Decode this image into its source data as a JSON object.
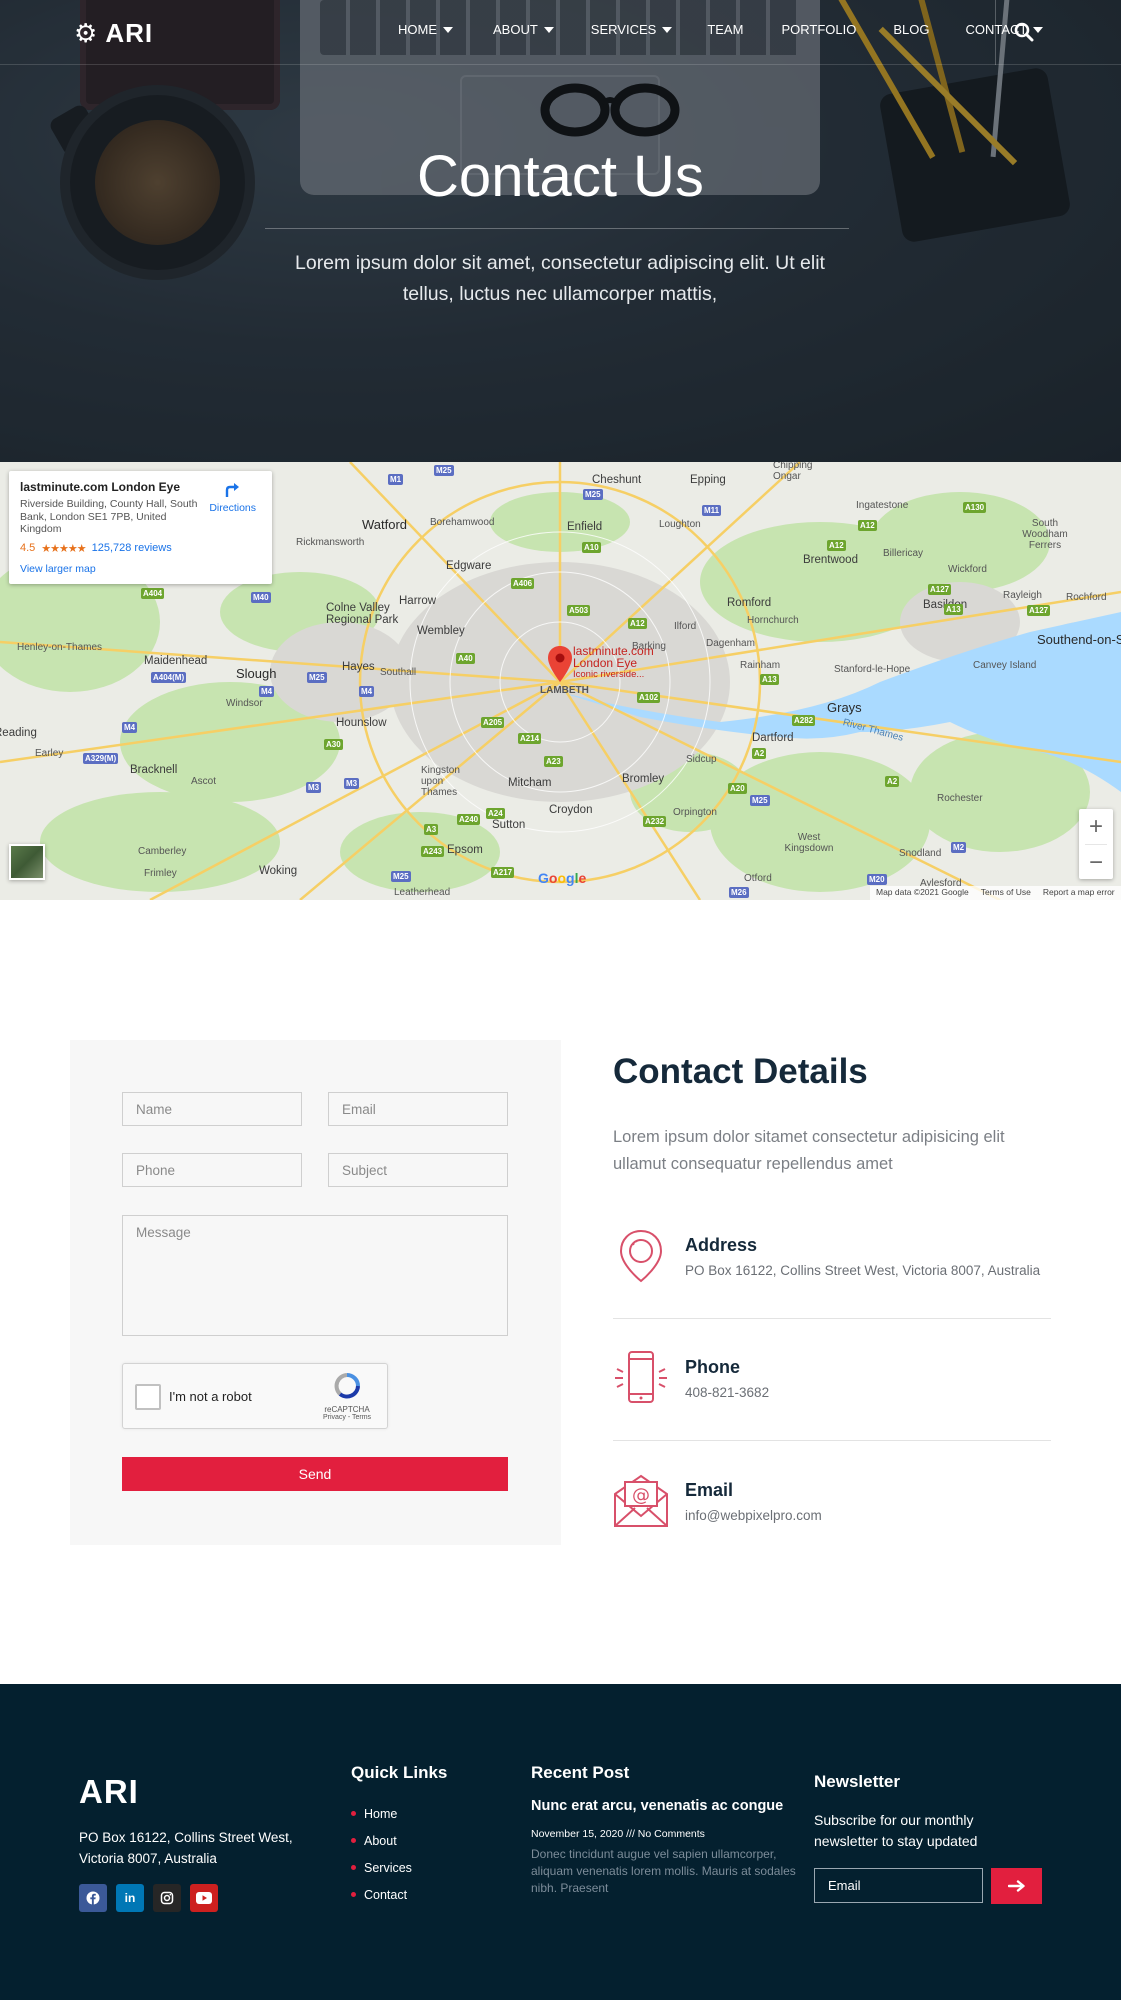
{
  "nav": {
    "logo": "ARI",
    "items": [
      {
        "label": "HOME",
        "has_dropdown": true
      },
      {
        "label": "ABOUT",
        "has_dropdown": true
      },
      {
        "label": "SERVICES",
        "has_dropdown": true
      },
      {
        "label": "TEAM",
        "has_dropdown": false
      },
      {
        "label": "PORTFOLIO",
        "has_dropdown": false
      },
      {
        "label": "BLOG",
        "has_dropdown": false
      },
      {
        "label": "CONTACT",
        "has_dropdown": true
      }
    ],
    "search_icon": "search-icon"
  },
  "hero": {
    "title": "Contact Us",
    "subtitle": "Lorem ipsum dolor sit amet, consectetur adipiscing elit. Ut elit tellus, luctus nec ullamcorper mattis,"
  },
  "map": {
    "place_name": "lastminute.com London Eye",
    "address": "Riverside Building, County Hall, South Bank, London SE1 7PB, United Kingdom",
    "rating": "4.5",
    "stars": "★★★★★",
    "reviews": "125,728 reviews",
    "directions": "Directions",
    "view_larger": "View larger map",
    "pin_title": "lastminute.com",
    "pin_title2": "London Eye",
    "pin_sub": "Iconic riverside...",
    "zoom_in": "+",
    "zoom_out": "−",
    "google": "Google",
    "attribution": [
      "Map data ©2021 Google",
      "Terms of Use",
      "Report a map error"
    ],
    "places": [
      "Cheshunt",
      "Epping",
      "Chipping Ongar",
      "Watford",
      "Borehamwood",
      "Enfield",
      "Loughton",
      "Ingatestone",
      "Rickmansworth",
      "Brentwood",
      "Billericay",
      "South Woodham Ferrers",
      "Edgware",
      "Colne Valley Regional Park",
      "Harrow",
      "Romford",
      "Wickford",
      "Rayleigh",
      "Rochford",
      "Hornchurch",
      "Basildon",
      "Southend-on-Sea",
      "Wembley",
      "Ilford",
      "Barking",
      "Dagenham",
      "Henley-on-Thames",
      "Maidenhead",
      "Slough",
      "Hayes",
      "Southall",
      "LAMBETH",
      "Rainham",
      "Stanford-le-Hope",
      "Canvey Island",
      "Windsor",
      "Hounslow",
      "Grays",
      "River Thames",
      "Reading",
      "Earley",
      "Bracknell",
      "Ascot",
      "Dartford",
      "Kingston upon Thames",
      "Mitcham",
      "Sidcup",
      "Bromley",
      "Croydon",
      "Orpington",
      "Rochester",
      "Sutton",
      "Camberley",
      "Epsom",
      "West Kingsdown",
      "Snodland",
      "Woking",
      "Frimley",
      "Leatherhead",
      "Otford",
      "Aylesford"
    ],
    "roads": [
      "M25",
      "M1",
      "M25",
      "M11",
      "A10",
      "A12",
      "A130",
      "A12",
      "A127",
      "A127",
      "A13",
      "A404",
      "M40",
      "A406",
      "A503",
      "A12",
      "A40",
      "A13",
      "M4",
      "A404(M)",
      "M25",
      "M4",
      "A102",
      "A282",
      "A2",
      "M4",
      "A329(M)",
      "A30",
      "M3",
      "A205",
      "A214",
      "A23",
      "A20",
      "M25",
      "A2",
      "A3",
      "A240",
      "A24",
      "A232",
      "A243",
      "A217",
      "M25",
      "M20",
      "M26",
      "M2",
      "M3"
    ]
  },
  "form": {
    "name_placeholder": "Name",
    "email_placeholder": "Email",
    "phone_placeholder": "Phone",
    "subject_placeholder": "Subject",
    "message_placeholder": "Message",
    "captcha_label": "I'm not a robot",
    "captcha_brand": "reCAPTCHA",
    "captcha_links": "Privacy - Terms",
    "send_label": "Send"
  },
  "contact": {
    "title": "Contact Details",
    "intro": "Lorem ipsum dolor sitamet consectetur adipisicing elit ullamut consequatur repellendus amet",
    "address_title": "Address",
    "address_value": "PO Box 16122, Collins Street West, Victoria 8007, Australia",
    "phone_title": "Phone",
    "phone_value": "408-821-3682",
    "email_title": "Email",
    "email_value": "info@webpixelpro.com",
    "accent": "#e21f3e"
  },
  "footer": {
    "logo": "ARI",
    "address": "PO Box 16122, Collins Street West, Victoria 8007, Australia",
    "socials": [
      "facebook-icon",
      "linkedin-icon",
      "instagram-icon",
      "youtube-icon"
    ],
    "quick_links_title": "Quick Links",
    "quick_links": [
      "Home",
      "About",
      "Services",
      "Contact"
    ],
    "recent_post_title": "Recent Post",
    "post_title": "Nunc erat arcu, venenatis ac congue",
    "post_meta": "November 15, 2020 /// No Comments",
    "post_excerpt": "Donec tincidunt augue vel sapien ullamcorper, aliquam venenatis lorem mollis. Mauris at sodales nibh. Praesent",
    "newsletter_title": "Newsletter",
    "newsletter_text": "Subscribe for our monthly newsletter to stay updated",
    "email_placeholder": "Email",
    "bg": "#04202f"
  }
}
